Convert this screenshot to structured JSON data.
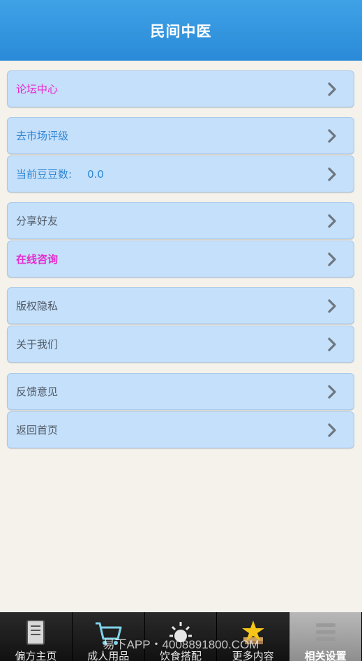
{
  "header": {
    "title": "民间中医"
  },
  "menu": {
    "forum": "论坛中心",
    "rate": "去市场评级",
    "beans_label": "当前豆豆数:",
    "beans_value": "0.0",
    "share": "分享好友",
    "consult": "在线咨询",
    "privacy": "版权隐私",
    "about": "关于我们",
    "feedback": "反馈意见",
    "home": "返回首页"
  },
  "tabs": [
    {
      "label": "偏方主页",
      "icon": "book-icon"
    },
    {
      "label": "成人用品",
      "icon": "cart-icon"
    },
    {
      "label": "饮食搭配",
      "icon": "sun-icon"
    },
    {
      "label": "更多内容",
      "icon": "star-icon"
    },
    {
      "label": "相关设置",
      "icon": "list-icon",
      "active": true
    }
  ],
  "watermark": "易下APP・4008891800.COM",
  "colors": {
    "header": "#2a8ad8",
    "row": "#c5e0fb",
    "pink": "#e52ccf",
    "blue": "#2f86d4"
  }
}
